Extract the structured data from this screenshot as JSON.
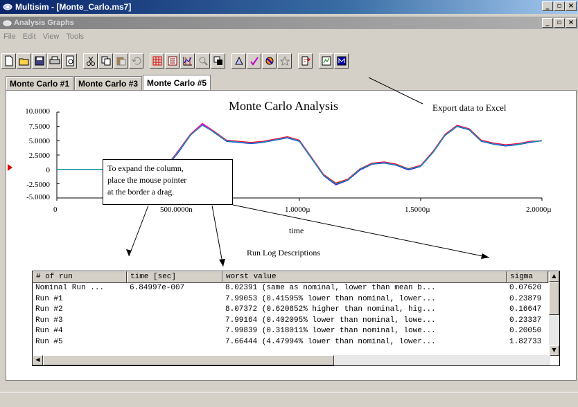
{
  "app": {
    "window_title": "Multisim - [Monte_Carlo.ms7]",
    "child_title": "Analysis Graphs",
    "window_buttons": [
      "_",
      "▫",
      "×"
    ]
  },
  "menu": [
    "File",
    "Edit",
    "View",
    "Tools"
  ],
  "toolbar_icons": [
    "new-icon",
    "open-icon",
    "save-icon",
    "print-icon",
    "print-preview-icon",
    "cut-icon",
    "copy-icon",
    "paste-icon",
    "undo-icon",
    "grid-icon",
    "legend-icon",
    "cursors-icon",
    "zoom-icon",
    "overlay-icon",
    "select-traces-icon",
    "reverse-colors-icon",
    "properties-icon",
    "zoom-restore-icon",
    "export-excel-icon",
    "export-mathcad-icon",
    "export-lvm-icon"
  ],
  "tabs": [
    {
      "label": "Monte Carlo #1",
      "active": false
    },
    {
      "label": "Monte Carlo #3",
      "active": false
    },
    {
      "label": "Monte Carlo #5",
      "active": true
    }
  ],
  "annotations": {
    "export_callout": "Export data to Excel",
    "note": [
      "To expand the column,",
      "place the mouse pointer",
      "at the border a drag."
    ]
  },
  "chart_data": {
    "type": "line",
    "title": "Monte Carlo Analysis",
    "xlabel": "time",
    "ylabel": "",
    "xlim": [
      0,
      2.0
    ],
    "ylim": [
      -5.0,
      10.0
    ],
    "x_ticks": [
      "0",
      "500.0000n",
      "1.0000µ",
      "1.5000µ",
      "2.0000µ"
    ],
    "y_ticks": [
      "10.0000",
      "7.5000",
      "5.0000",
      "2.5000",
      "0",
      "-2.5000",
      "-5.0000"
    ],
    "series_colors": [
      "#00c000",
      "#ff0000",
      "#0000ff",
      "#ff00ff",
      "#00a0a0"
    ],
    "x": [
      0,
      0.1,
      0.2,
      0.3,
      0.4,
      0.45,
      0.5,
      0.55,
      0.6,
      0.65,
      0.7,
      0.75,
      0.8,
      0.85,
      0.9,
      0.95,
      1.0,
      1.05,
      1.1,
      1.15,
      1.2,
      1.25,
      1.3,
      1.35,
      1.4,
      1.45,
      1.5,
      1.55,
      1.6,
      1.65,
      1.7,
      1.75,
      1.8,
      1.85,
      1.9,
      1.95,
      2.0
    ],
    "series": [
      {
        "values": [
          0,
          0,
          0,
          0,
          0,
          0.4,
          3.0,
          6.0,
          8.0,
          6.5,
          5.0,
          4.8,
          4.6,
          4.8,
          5.2,
          5.6,
          5.0,
          2.0,
          -1.0,
          -2.5,
          -1.8,
          0.0,
          1.0,
          1.2,
          0.8,
          0.0,
          0.6,
          3.0,
          6.0,
          7.6,
          7.0,
          5.0,
          4.5,
          4.2,
          4.4,
          4.8,
          5.0
        ]
      },
      {
        "values": [
          0,
          0,
          0,
          0,
          0,
          0.5,
          3.2,
          6.1,
          8.02,
          6.6,
          5.1,
          4.9,
          4.7,
          4.9,
          5.3,
          5.7,
          5.1,
          2.1,
          -0.9,
          -2.4,
          -1.7,
          0.1,
          1.1,
          1.3,
          0.9,
          0.1,
          0.7,
          3.1,
          6.1,
          7.7,
          7.1,
          5.1,
          4.6,
          4.3,
          4.5,
          4.9,
          5.0
        ]
      },
      {
        "values": [
          0,
          0,
          0,
          0,
          0,
          0.3,
          2.9,
          5.9,
          7.9,
          6.4,
          4.9,
          4.7,
          4.5,
          4.7,
          5.1,
          5.5,
          4.9,
          1.9,
          -1.1,
          -2.7,
          -1.9,
          -0.1,
          0.9,
          1.1,
          0.7,
          -0.1,
          0.5,
          2.9,
          5.9,
          7.5,
          6.9,
          4.9,
          4.4,
          4.1,
          4.3,
          4.7,
          5.0
        ]
      },
      {
        "values": [
          0,
          0,
          0,
          0,
          0,
          0.4,
          3.1,
          6.0,
          7.95,
          6.5,
          5.0,
          4.8,
          4.6,
          4.8,
          5.2,
          5.6,
          5.0,
          2.0,
          -1.0,
          -2.6,
          -1.8,
          0.0,
          1.0,
          1.2,
          0.8,
          0.0,
          0.6,
          3.0,
          6.0,
          7.6,
          7.0,
          5.0,
          4.5,
          4.2,
          4.4,
          4.8,
          5.0
        ]
      },
      {
        "values": [
          0,
          0,
          0,
          0,
          0,
          0.45,
          3.0,
          5.95,
          7.7,
          6.45,
          4.95,
          4.75,
          4.55,
          4.75,
          5.15,
          5.55,
          4.95,
          1.95,
          -1.05,
          -2.55,
          -1.85,
          0.05,
          0.95,
          1.15,
          0.75,
          0.05,
          0.55,
          2.95,
          5.95,
          7.55,
          6.95,
          4.95,
          4.45,
          4.15,
          4.35,
          4.75,
          5.0
        ]
      }
    ]
  },
  "runlog": {
    "title": "Run Log Descriptions",
    "columns": [
      "# of run",
      "time [sec]",
      "worst value",
      "sigma"
    ],
    "rows": [
      [
        "Nominal Run ...",
        "6.84997e-007",
        "8.02391 (same as nominal,  lower than mean b...",
        "0.07620"
      ],
      [
        "Run #1",
        "",
        "7.99053 (0.41595% lower than nominal,  lower...",
        "0.23879"
      ],
      [
        "Run #2",
        "",
        "8.07372 (0.620852% higher than nominal,  hig...",
        "0.16647"
      ],
      [
        "Run #3",
        "",
        "7.99164 (0.402095% lower than nominal,  lowe...",
        "0.23337"
      ],
      [
        "Run #4",
        "",
        "7.99839 (0.318011% lower than nominal,  lowe...",
        "0.20050"
      ],
      [
        "Run #5",
        "",
        "7.66444 (4.47994% lower than nominal,  lower...",
        "1.82733"
      ]
    ]
  }
}
